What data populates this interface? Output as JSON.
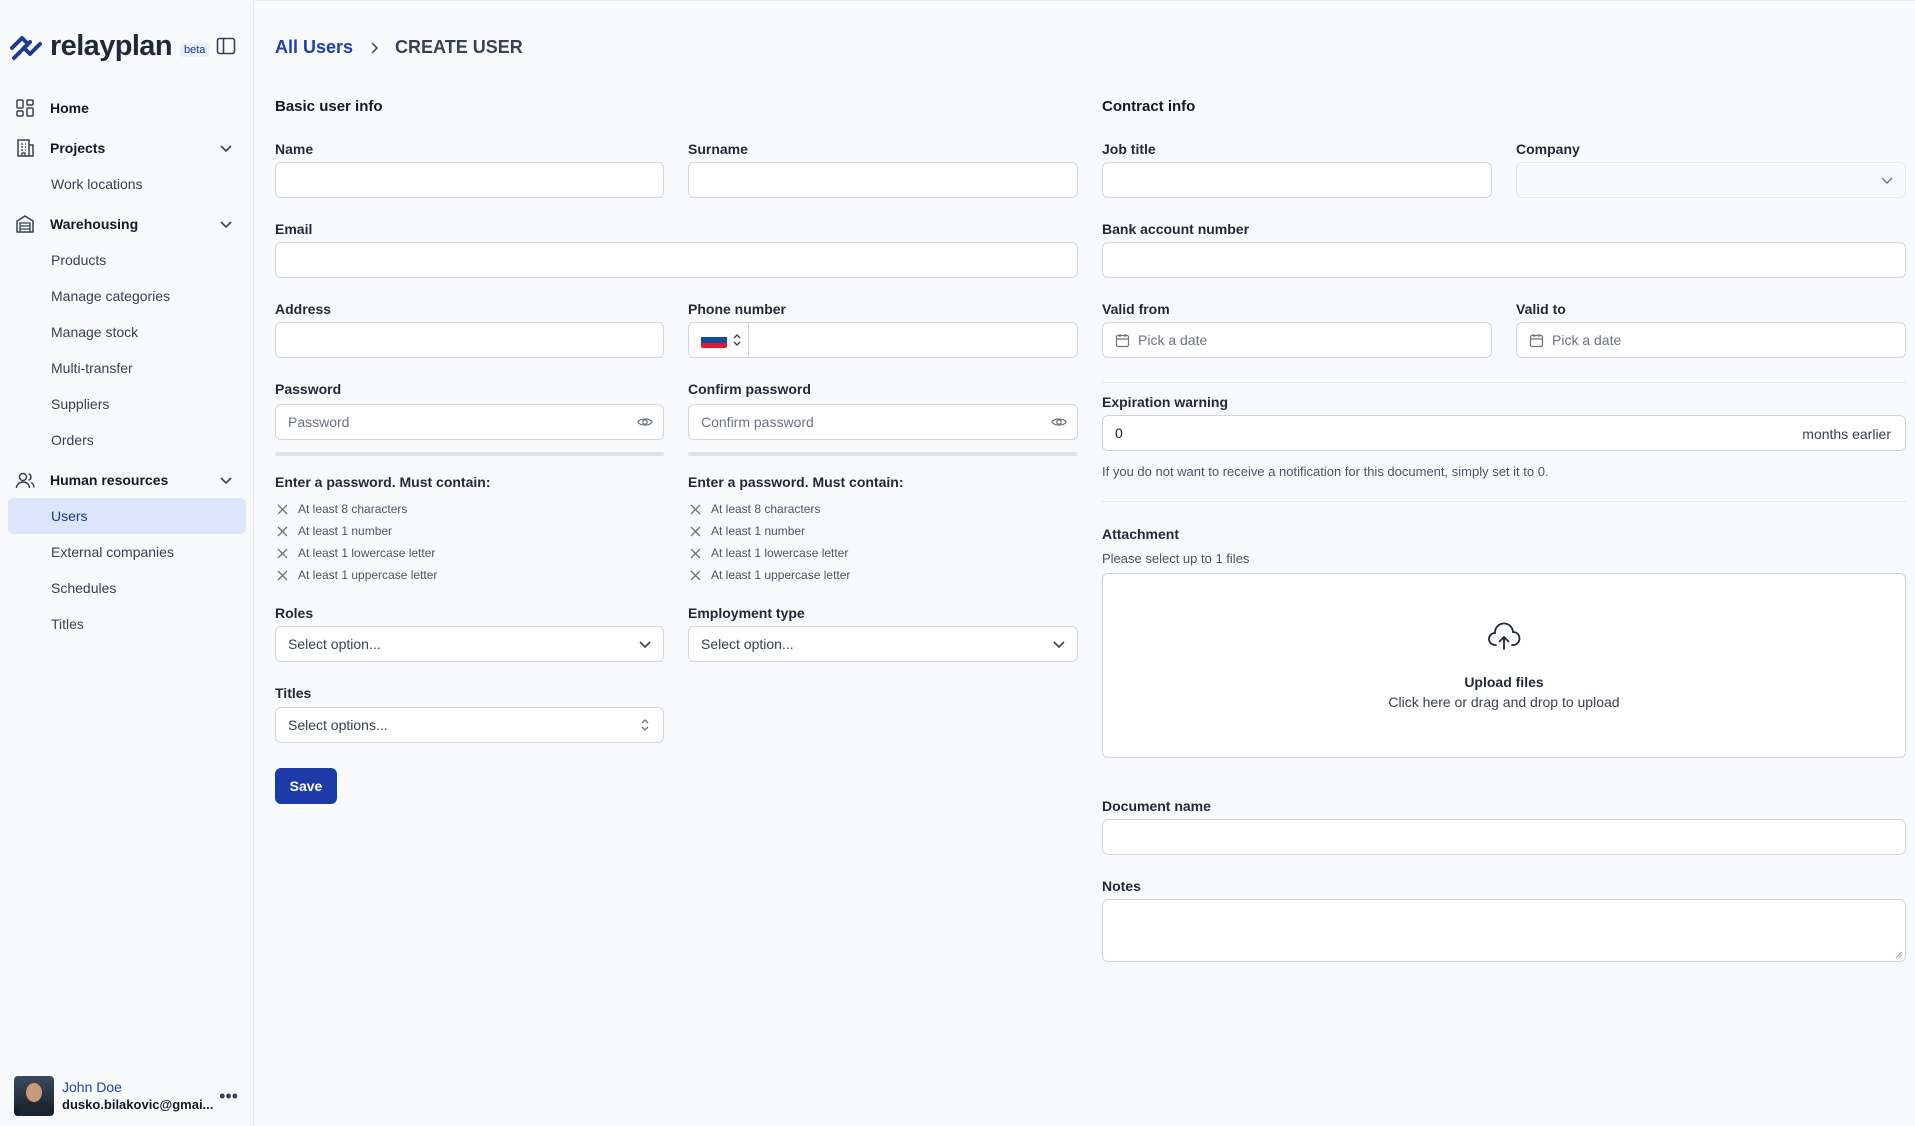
{
  "brand": {
    "name": "relayplan",
    "badge": "beta"
  },
  "nav": {
    "home": "Home",
    "projects": {
      "label": "Projects",
      "items": [
        "Work locations"
      ]
    },
    "warehousing": {
      "label": "Warehousing",
      "items": [
        "Products",
        "Manage categories",
        "Manage stock",
        "Multi-transfer",
        "Suppliers",
        "Orders"
      ]
    },
    "hr": {
      "label": "Human resources",
      "items": [
        "Users",
        "External companies",
        "Schedules",
        "Titles"
      ]
    }
  },
  "user": {
    "name": "John Doe",
    "email": "dusko.bilakovic@gmai..."
  },
  "breadcrumb": {
    "parent": "All Users",
    "current": "CREATE USER"
  },
  "basic": {
    "title": "Basic user info",
    "name_label": "Name",
    "surname_label": "Surname",
    "email_label": "Email",
    "address_label": "Address",
    "phone_label": "Phone number",
    "password_label": "Password",
    "password_placeholder": "Password",
    "confirm_label": "Confirm password",
    "confirm_placeholder": "Confirm password",
    "pw_hint": "Enter a password. Must contain:",
    "requirements": [
      "At least 8 characters",
      "At least 1 number",
      "At least 1 lowercase letter",
      "At least 1 uppercase letter"
    ],
    "roles_label": "Roles",
    "roles_placeholder": "Select option...",
    "employment_label": "Employment type",
    "employment_placeholder": "Select option...",
    "titles_label": "Titles",
    "titles_placeholder": "Select options...",
    "save": "Save"
  },
  "contract": {
    "title": "Contract info",
    "job_label": "Job title",
    "company_label": "Company",
    "bank_label": "Bank account number",
    "valid_from_label": "Valid from",
    "valid_to_label": "Valid to",
    "date_placeholder": "Pick a date",
    "exp_label": "Expiration warning",
    "exp_value": "0",
    "exp_suffix": "months earlier",
    "exp_help": "If you do not want to receive a notification for this document, simply set it to 0.",
    "attach_label": "Attachment",
    "attach_help": "Please select up to 1 files",
    "upload_title": "Upload files",
    "upload_sub": "Click here or drag and drop to upload",
    "docname_label": "Document name",
    "notes_label": "Notes"
  },
  "colors": {
    "primary": "#1e3aa8",
    "active_bg": "#dbe5fb",
    "link": "#1e40af"
  }
}
